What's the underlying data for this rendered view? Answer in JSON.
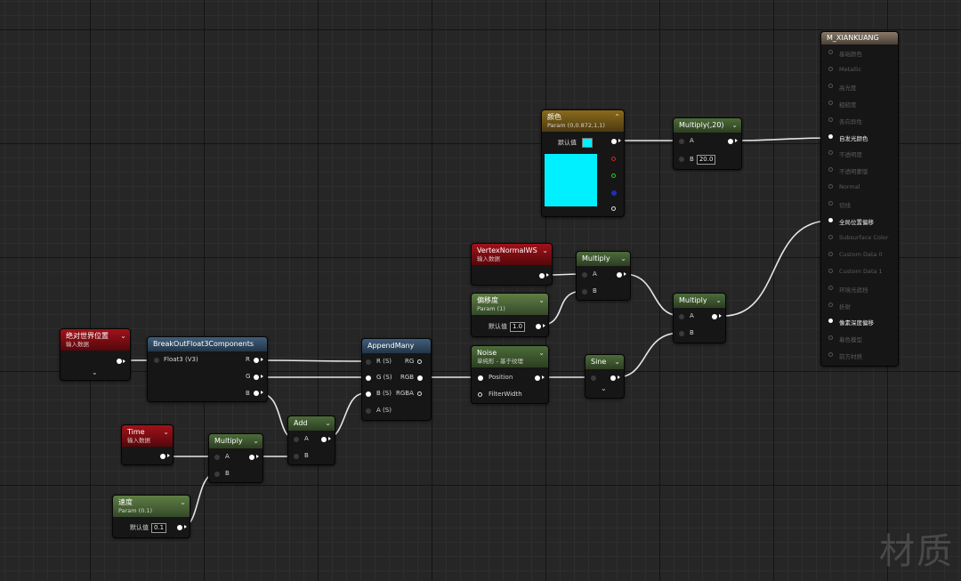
{
  "colors": {
    "param_color": "#00f0ff"
  },
  "nodes": {
    "abs_world_pos": {
      "title": "绝对世界位置",
      "subtitle": "输入数据"
    },
    "breakout": {
      "title": "BreakOutFloat3Components",
      "input": "Float3 (V3)",
      "outputs": [
        "R",
        "G",
        "B"
      ]
    },
    "time": {
      "title": "Time",
      "subtitle": "输入数据"
    },
    "speed": {
      "title": "速度",
      "subtitle": "Param (0.1)",
      "default_label": "默认值",
      "value": "0.1"
    },
    "multiply_time": {
      "title": "Multiply",
      "inputs": [
        "A",
        "B"
      ]
    },
    "add": {
      "title": "Add",
      "inputs": [
        "A",
        "B"
      ]
    },
    "append_many": {
      "title": "AppendMany",
      "inputs": [
        "R (S)",
        "G (S)",
        "B (S)",
        "A (S)"
      ],
      "outputs": [
        "RG",
        "RGB",
        "RGBA"
      ]
    },
    "vertex_normal": {
      "title": "VertexNormalWS",
      "subtitle": "输入数据"
    },
    "offset": {
      "title": "偏移度",
      "subtitle": "Param (1)",
      "default_label": "默认值",
      "value": "1.0"
    },
    "multiply_normal": {
      "title": "Multiply",
      "inputs": [
        "A",
        "B"
      ]
    },
    "noise": {
      "title": "Noise",
      "subtitle": "单纯形 - 基于纹理",
      "inputs": [
        "Position",
        "FilterWidth"
      ]
    },
    "sine": {
      "title": "Sine"
    },
    "multiply_final": {
      "title": "Multiply",
      "inputs": [
        "A",
        "B"
      ]
    },
    "color_param": {
      "title": "颜色",
      "subtitle": "Param (0,0.872,1,1)",
      "default_label": "默认值"
    },
    "multiply_20": {
      "title": "Multiply(,20)",
      "inputs": [
        "A",
        "B"
      ],
      "b_value": "20.0"
    },
    "material": {
      "title": "M_XIANKUANG",
      "rows": [
        {
          "label": "基础颜色",
          "active": false
        },
        {
          "label": "Metallic",
          "active": false
        },
        {
          "label": "高光度",
          "active": false
        },
        {
          "label": "粗糙度",
          "active": false
        },
        {
          "label": "各向异性",
          "active": false
        },
        {
          "label": "自发光颜色",
          "active": true
        },
        {
          "label": "不透明度",
          "active": false
        },
        {
          "label": "不透明蒙版",
          "active": false
        },
        {
          "label": "Normal",
          "active": false
        },
        {
          "label": "切线",
          "active": false
        },
        {
          "label": "全局位置偏移",
          "active": true
        },
        {
          "label": "Subsurface Color",
          "active": false
        },
        {
          "label": "Custom Data 0",
          "active": false
        },
        {
          "label": "Custom Data 1",
          "active": false
        },
        {
          "label": "环境光遮挡",
          "active": false
        },
        {
          "label": "折射",
          "active": false
        },
        {
          "label": "像素深度偏移",
          "active": true
        },
        {
          "label": "着色模型",
          "active": false
        },
        {
          "label": "前方材质",
          "active": false
        }
      ]
    }
  },
  "watermark": "材质"
}
